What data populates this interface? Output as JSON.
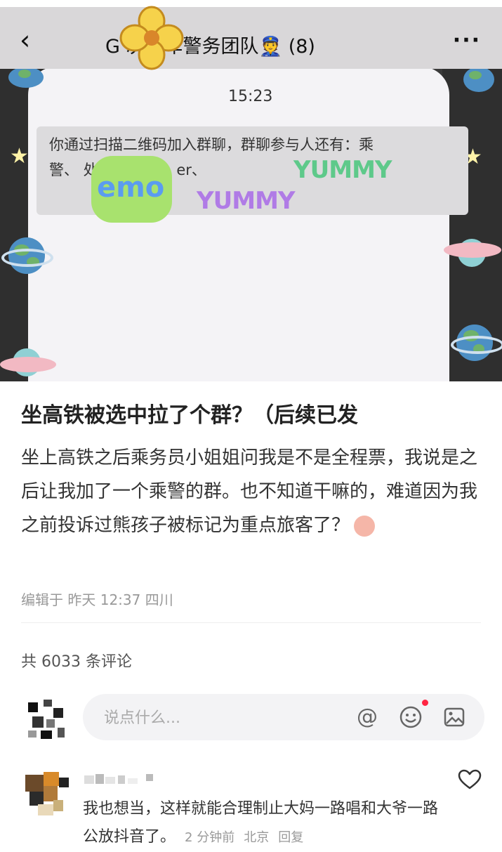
{
  "header": {
    "title": "G  次列车警务团队👮 (8)",
    "back_icon": "‹",
    "more_icon": "···"
  },
  "chat": {
    "time": "15:23",
    "system_line1": "你通过扫描二维码加入群聊，群聊参与人还有：乘",
    "system_line2": "警、       处乘警支队、          er、",
    "sticker_emo": "emo",
    "sticker_yummy1": "YUMMY",
    "sticker_yummy2": "YUMMY"
  },
  "post": {
    "title": "坐高铁被选中拉了个群？（后续已发",
    "body": "坐上高铁之后乘务员小姐姐问我是不是全程票，我说是之后让我加了一个乘警的群。也不知道干嘛的，难道因为我之前投诉过熊孩子被标记为重点旅客了？",
    "edit_info": "编辑于 昨天 12:37 四川"
  },
  "comments": {
    "count_label": "共 6033 条评论",
    "input_placeholder": "说点什么...",
    "items": [
      {
        "text": "我也想当，这样就能合理制止大妈一路唱和大爷一路公放抖音了。",
        "time": "2 分钟前",
        "location": "北京",
        "reply_label": "回复"
      }
    ]
  },
  "colors": {
    "accent": "#ff2442",
    "nav_bg": "#d9d7d9",
    "system_msg_bg": "#dcdbdd"
  }
}
